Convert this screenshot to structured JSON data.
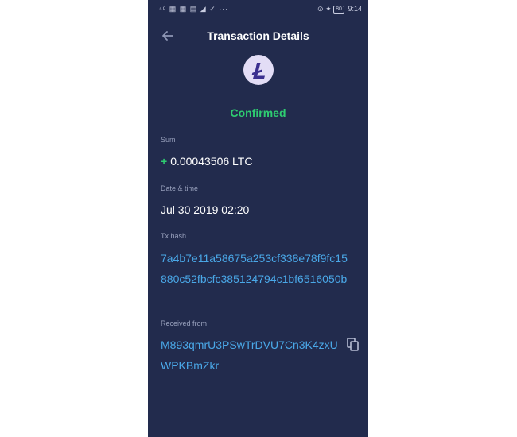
{
  "status_bar": {
    "left_icons": "⁴ᵍ ▦ ▦ ▤ ◢ ✓ ···",
    "right_icons": "⊙ ✦",
    "battery": "80",
    "time": "9:14"
  },
  "header": {
    "title": "Transaction Details"
  },
  "transaction": {
    "status": "Confirmed",
    "sum_label": "Sum",
    "sum_sign": "+",
    "sum_value": "0.00043506 LTC",
    "date_label": "Date & time",
    "date_value": "Jul 30 2019 02:20",
    "hash_label": "Tx hash",
    "hash_value": "7a4b7e11a58675a253cf338e78f9fc15880c52fbcfc385124794c1bf6516050b",
    "from_label": "Received from",
    "from_value": "M893qmrU3PSwTrDVU7Cn3K4zxUWPKBmZkr"
  },
  "colors": {
    "background": "#222b4d",
    "confirmed": "#2ecc71",
    "link": "#4aa8e8",
    "label": "#98a0bc",
    "coin_badge": "#e3ddf6",
    "coin_accent": "#3b2f8f"
  },
  "icons": {
    "back": "arrow-left-icon",
    "coin": "litecoin-icon",
    "copy": "copy-icon"
  }
}
